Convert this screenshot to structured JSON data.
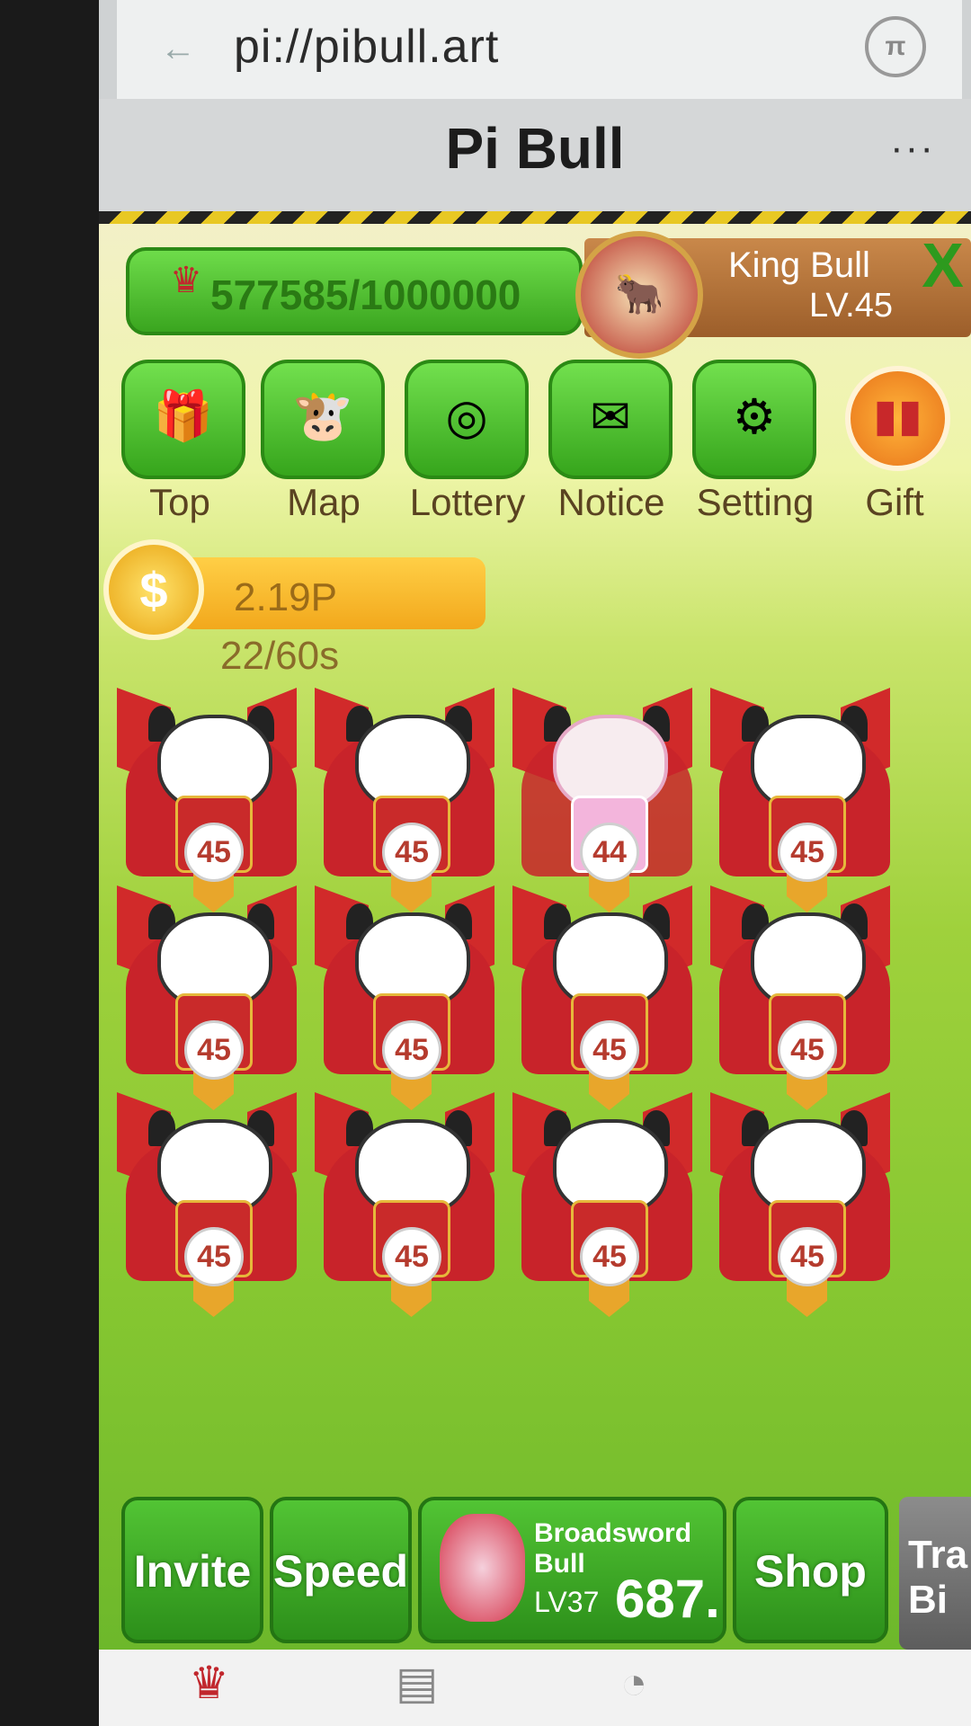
{
  "browser": {
    "url": "pi://pibull.art",
    "title": "Pi Bull",
    "more": "···"
  },
  "player": {
    "exp": "577585/1000000",
    "name": "King Bull",
    "level": "LV.45"
  },
  "menu": [
    {
      "label": "Top",
      "icon": "trophy-icon"
    },
    {
      "label": "Map",
      "icon": "map-icon"
    },
    {
      "label": "Lottery",
      "icon": "wheel-icon"
    },
    {
      "label": "Notice",
      "icon": "mail-icon"
    },
    {
      "label": "Setting",
      "icon": "gear-icon"
    },
    {
      "label": "Gift",
      "icon": "gift-icon"
    }
  ],
  "earnings": {
    "rate": "2.19P",
    "timer": "22/60s"
  },
  "grid": {
    "levels": [
      "45",
      "45",
      "44",
      "45",
      "45",
      "45",
      "45",
      "45",
      "45",
      "45",
      "45",
      "45"
    ]
  },
  "bottom": {
    "invite": "Invite",
    "speed": "Speed",
    "bull_name": "Broadsword Bull",
    "bull_level": "LV37",
    "bull_price": "687.",
    "shop": "Shop",
    "trash": "Tra\nBi"
  }
}
